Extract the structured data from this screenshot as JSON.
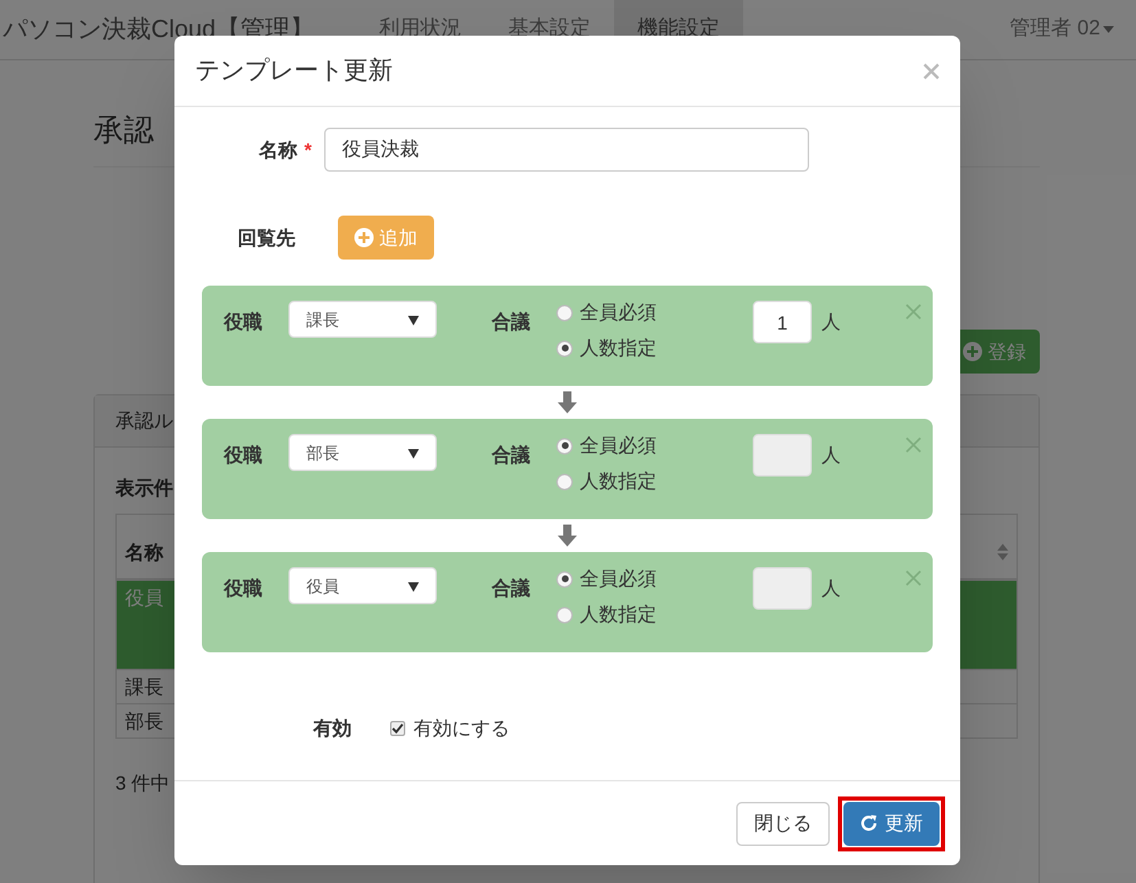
{
  "navbar": {
    "brand": "パソコン決裁Cloud【管理】",
    "items": [
      {
        "label": "利用状況",
        "selected": false
      },
      {
        "label": "基本設定",
        "selected": false
      },
      {
        "label": "機能設定",
        "selected": true
      }
    ],
    "user_menu": "管理者 02"
  },
  "background": {
    "heading": "承認",
    "register_button": "登録",
    "panel_title": "承認ル",
    "page_size_label": "表示件",
    "table": {
      "columns": [
        "名称"
      ],
      "rows": [
        {
          "name": "役員",
          "selected": true
        },
        {
          "name": "課長",
          "selected": false
        },
        {
          "name": "部長",
          "selected": false
        }
      ]
    },
    "pager_info": "3 件中"
  },
  "modal": {
    "title": "テンプレート更新",
    "name": {
      "label": "名称",
      "required_mark": "*",
      "value": "役員決裁"
    },
    "route": {
      "label": "回覧先",
      "add_button": "追加",
      "steps": [
        {
          "position_label": "役職",
          "position": "課長",
          "consensus_label": "合議",
          "options": [
            {
              "label": "全員必須",
              "selected": false
            },
            {
              "label": "人数指定",
              "selected": true
            }
          ],
          "count": "1",
          "disabled": false,
          "unit": "人"
        },
        {
          "position_label": "役職",
          "position": "部長",
          "consensus_label": "合議",
          "options": [
            {
              "label": "全員必須",
              "selected": true
            },
            {
              "label": "人数指定",
              "selected": false
            }
          ],
          "disabled": true,
          "unit": "人"
        },
        {
          "position_label": "役職",
          "position": "役員",
          "consensus_label": "合議",
          "options": [
            {
              "label": "全員必須",
              "selected": true
            },
            {
              "label": "人数指定",
              "selected": false
            }
          ],
          "disabled": true,
          "unit": "人"
        }
      ]
    },
    "enabled": {
      "label": "有効",
      "checkbox_label": "有効にする",
      "checked": true
    },
    "buttons": [
      {
        "label": "閉じる",
        "kind": "default",
        "highlighted": false
      },
      {
        "label": "更新",
        "kind": "primary",
        "highlighted": true
      }
    ]
  }
}
